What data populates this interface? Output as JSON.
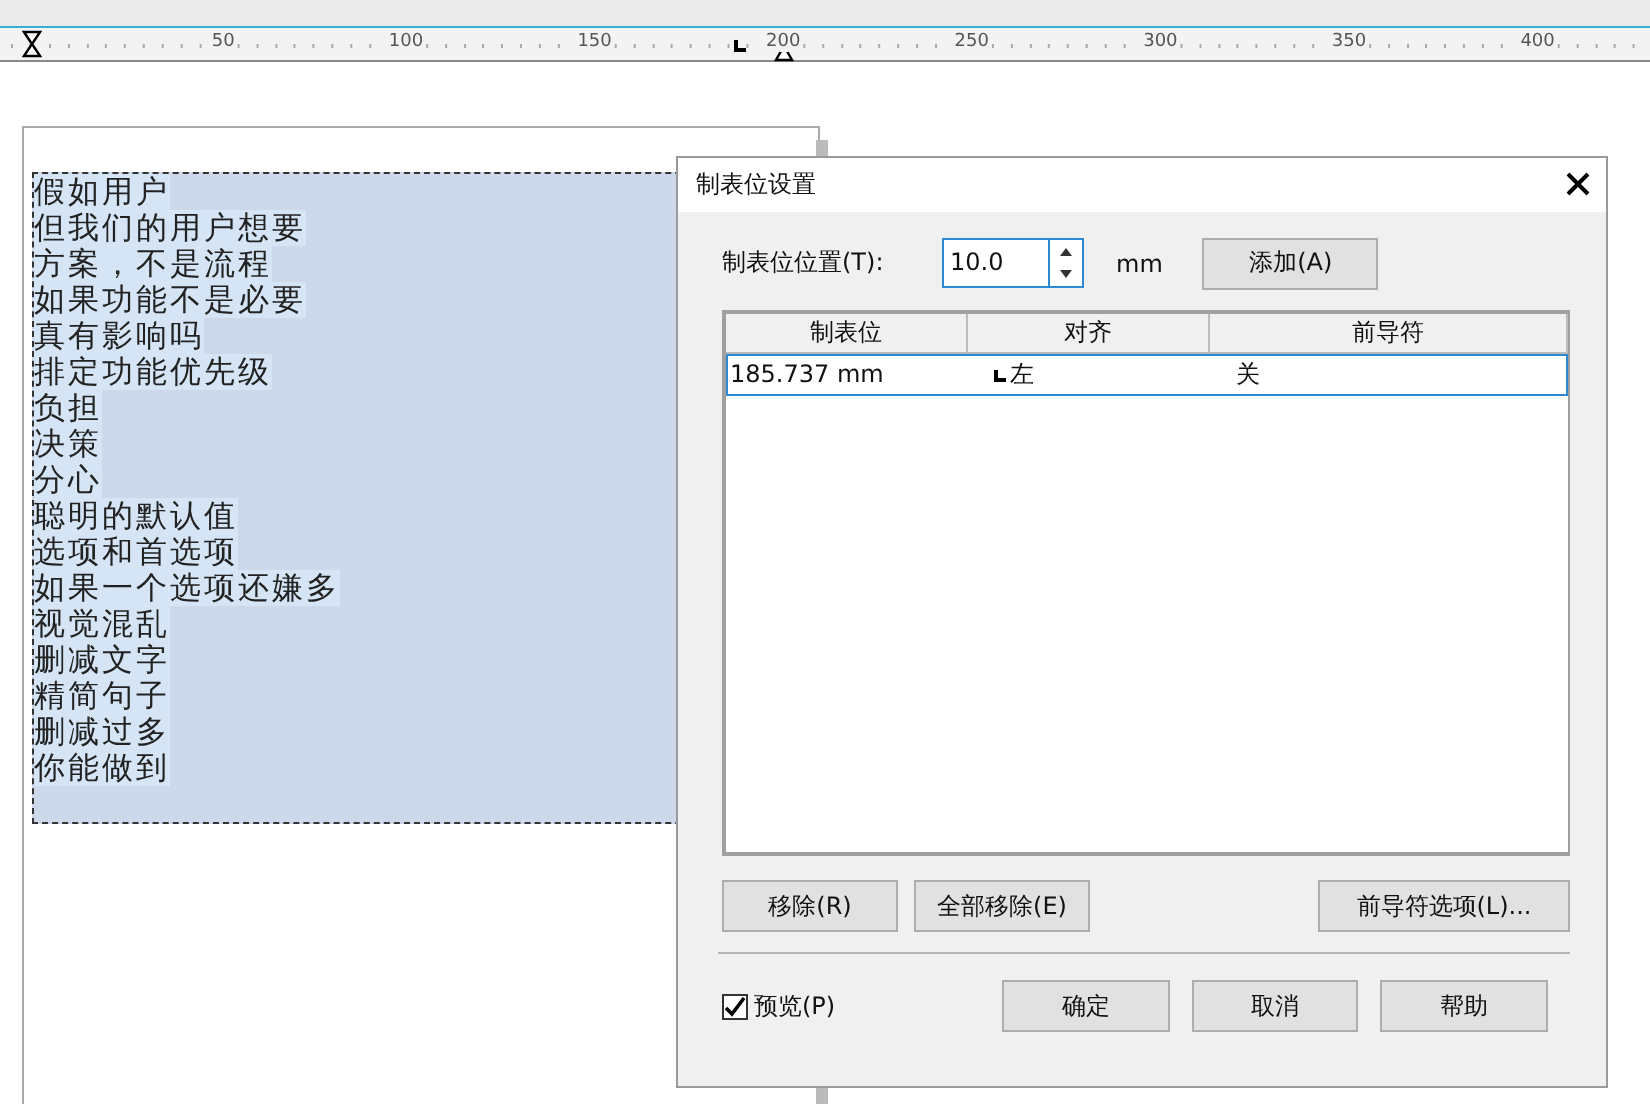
{
  "ruler": {
    "labels": [
      "50",
      "100",
      "150",
      "200",
      "250",
      "300",
      "350",
      "400"
    ]
  },
  "document": {
    "selected": true,
    "lines": [
      "假如用户",
      "但我们的用户想要",
      "方案，不是流程",
      "如果功能不是必要",
      "真有影响吗",
      "排定功能优先级",
      "负担",
      "决策",
      "分心",
      "聪明的默认值",
      "选项和首选项",
      "如果一个选项还嫌多",
      "视觉混乱",
      "删减文字",
      "精简句子",
      "删减过多",
      "你能做到"
    ]
  },
  "dialog": {
    "title": "制表位设置",
    "position_label": "制表位位置(T):",
    "position_value": "10.0",
    "unit": "mm",
    "add_button": "添加(A)",
    "table": {
      "columns": [
        "制表位",
        "对齐",
        "前导符"
      ],
      "rows": [
        {
          "cells": [
            "185.737 mm",
            "左",
            "关"
          ],
          "selected": true
        }
      ]
    },
    "buttons": [
      "移除(R)",
      "全部移除(E)",
      "前导符选项(L)..."
    ],
    "preview": {
      "label": "预览(P)",
      "checked": true
    },
    "footer_buttons": [
      "确定",
      "取消",
      "帮助"
    ]
  }
}
